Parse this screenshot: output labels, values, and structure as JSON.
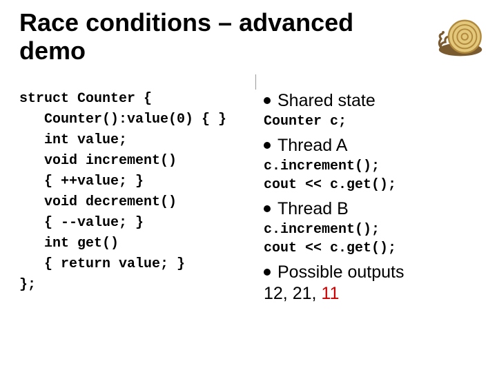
{
  "title": "Race conditions – advanced demo",
  "code_left": "struct Counter {\n   Counter():value(0) { }\n   int value;\n   void increment()\n   { ++value; }\n   void decrement()\n   { --value; }\n   int get()\n   { return value; }\n};",
  "right": {
    "b1": "Shared state",
    "c1": "Counter c;",
    "b2": "Thread A",
    "c2": "c.increment();\ncout << c.get();",
    "b3": "Thread B",
    "c3": "c.increment();\ncout << c.get();",
    "b4": "Possible outputs",
    "out_a": "12, 21, ",
    "out_b": "11"
  },
  "icon_name": "snail-icon"
}
